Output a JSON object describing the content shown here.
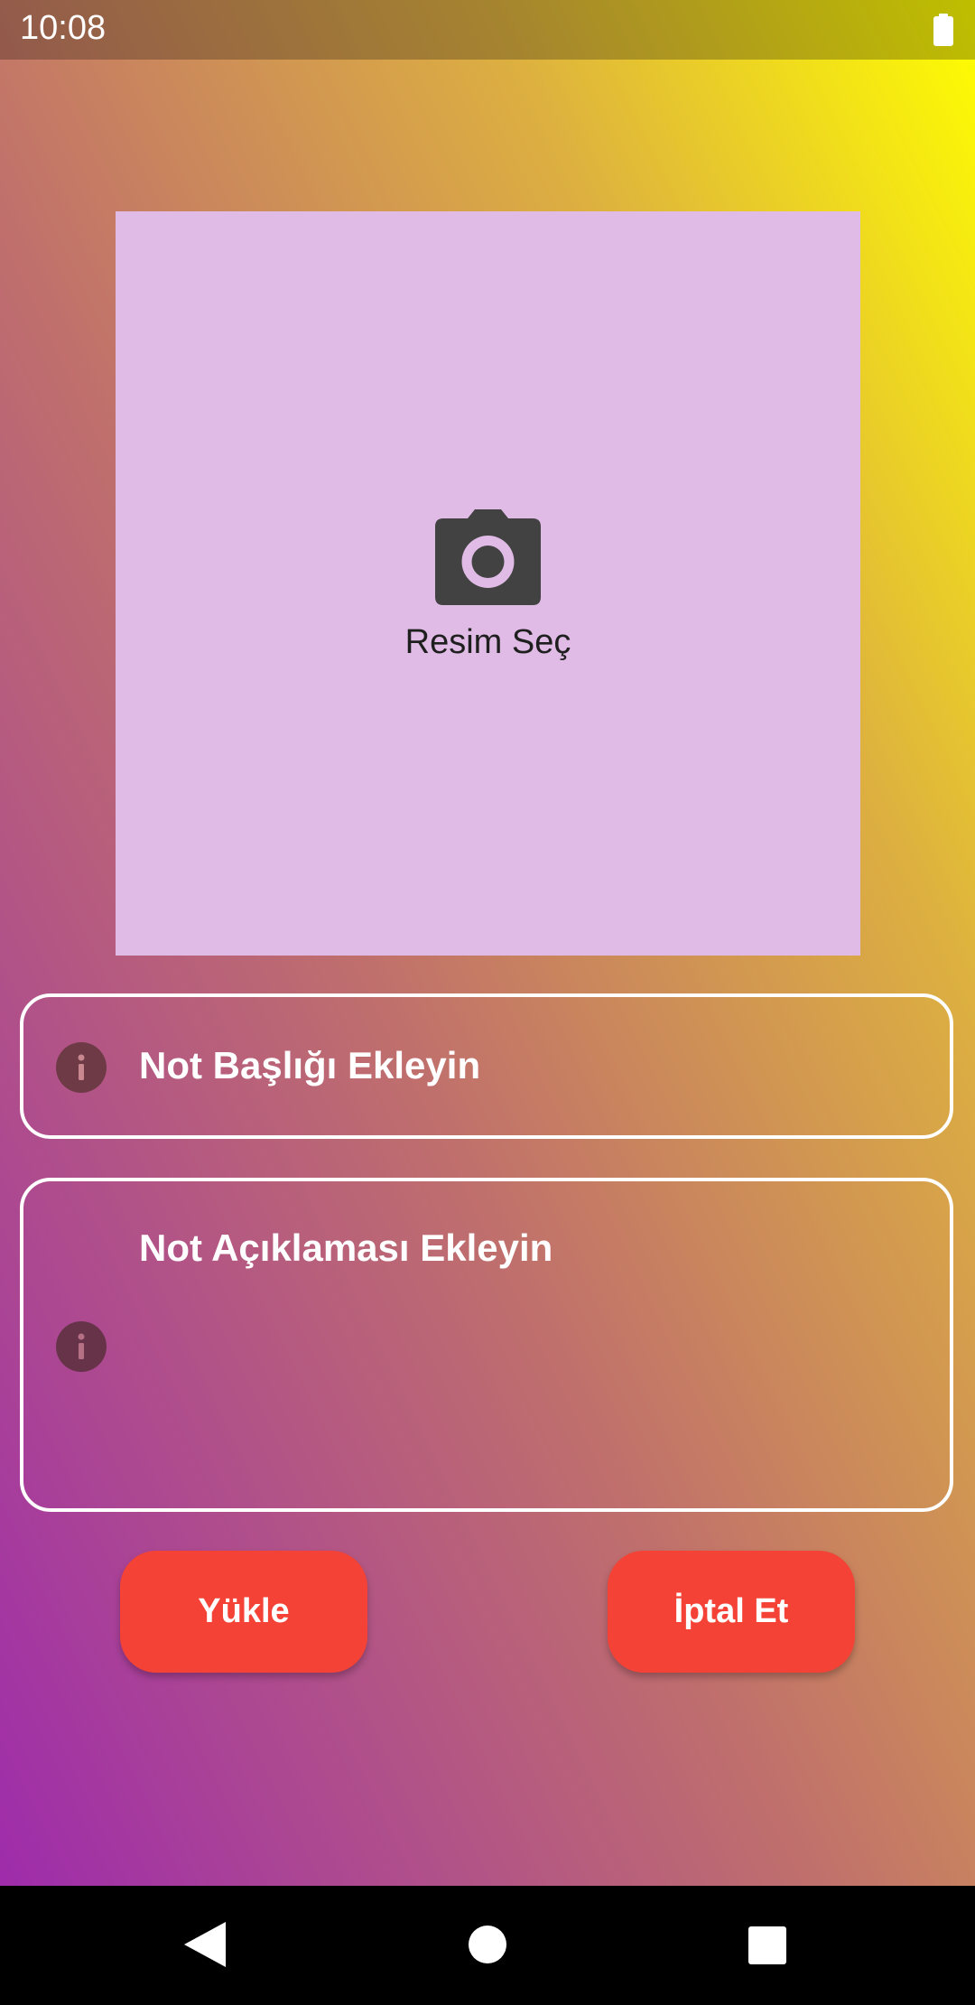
{
  "status_bar": {
    "time": "10:08",
    "battery_icon": "battery-full-icon"
  },
  "image_picker": {
    "icon": "camera-icon",
    "label": "Resim Seç"
  },
  "form": {
    "title_placeholder": "Not Başlığı Ekleyin",
    "description_placeholder": "Not Açıklaması Ekleyin",
    "field_icon": "info-icon"
  },
  "buttons": {
    "upload_label": "Yükle",
    "cancel_label": "İptal Et"
  },
  "nav_bar": {
    "icons": [
      "back-icon",
      "home-icon",
      "recents-icon"
    ]
  },
  "colors": {
    "gradient_start": "#9c27b0",
    "gradient_end": "#ffff00",
    "picker_background": "#dfbbe6",
    "button_background": "#f44336",
    "field_border": "#ffffff"
  }
}
